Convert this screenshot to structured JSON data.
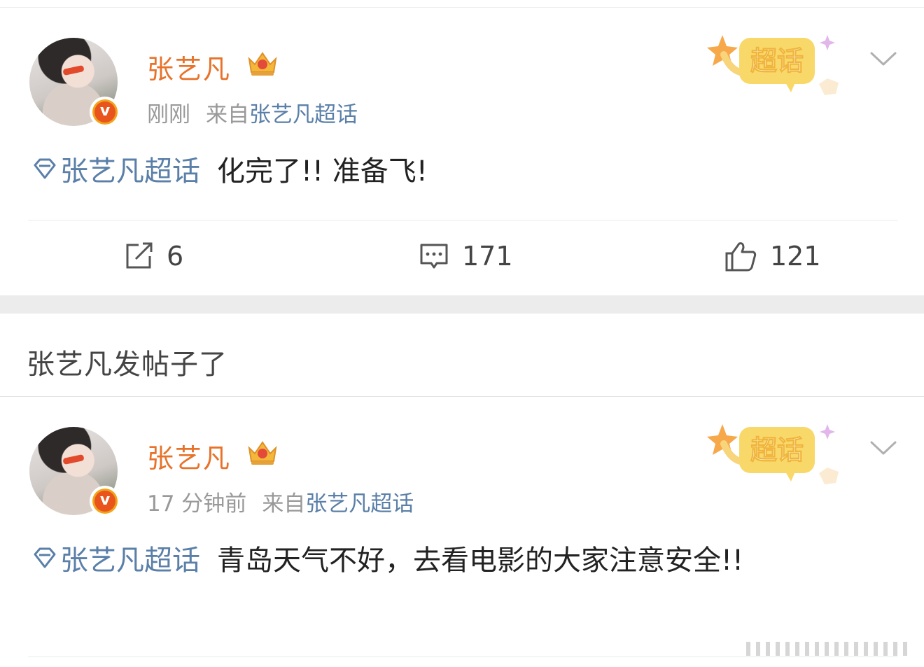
{
  "posts": [
    {
      "author": "张艺凡",
      "time": "刚刚",
      "source_prefix": "来自",
      "source_name": "张艺凡超话",
      "badge_text": "超话",
      "verify_mark": "v",
      "topic": "张艺凡超话",
      "text": "化完了!! 准备飞!",
      "reposts": "6",
      "comments": "171",
      "likes": "121"
    },
    {
      "author": "张艺凡",
      "time": "17 分钟前",
      "source_prefix": "来自",
      "source_name": "张艺凡超话",
      "badge_text": "超话",
      "verify_mark": "v",
      "topic": "张艺凡超话",
      "text": "青岛天气不好，去看电影的大家注意安全!!"
    }
  ],
  "section_title": "张艺凡发帖子了",
  "icons": {
    "repost": "repost-icon",
    "comment": "comment-icon",
    "like": "thumbs-up-icon",
    "crown": "crown-icon",
    "topic": "diamond-icon",
    "more": "chevron-down-icon"
  },
  "colors": {
    "author": "#e8722a",
    "link": "#5a7fa8",
    "meta": "#999999",
    "badge": "#f7c93a"
  }
}
